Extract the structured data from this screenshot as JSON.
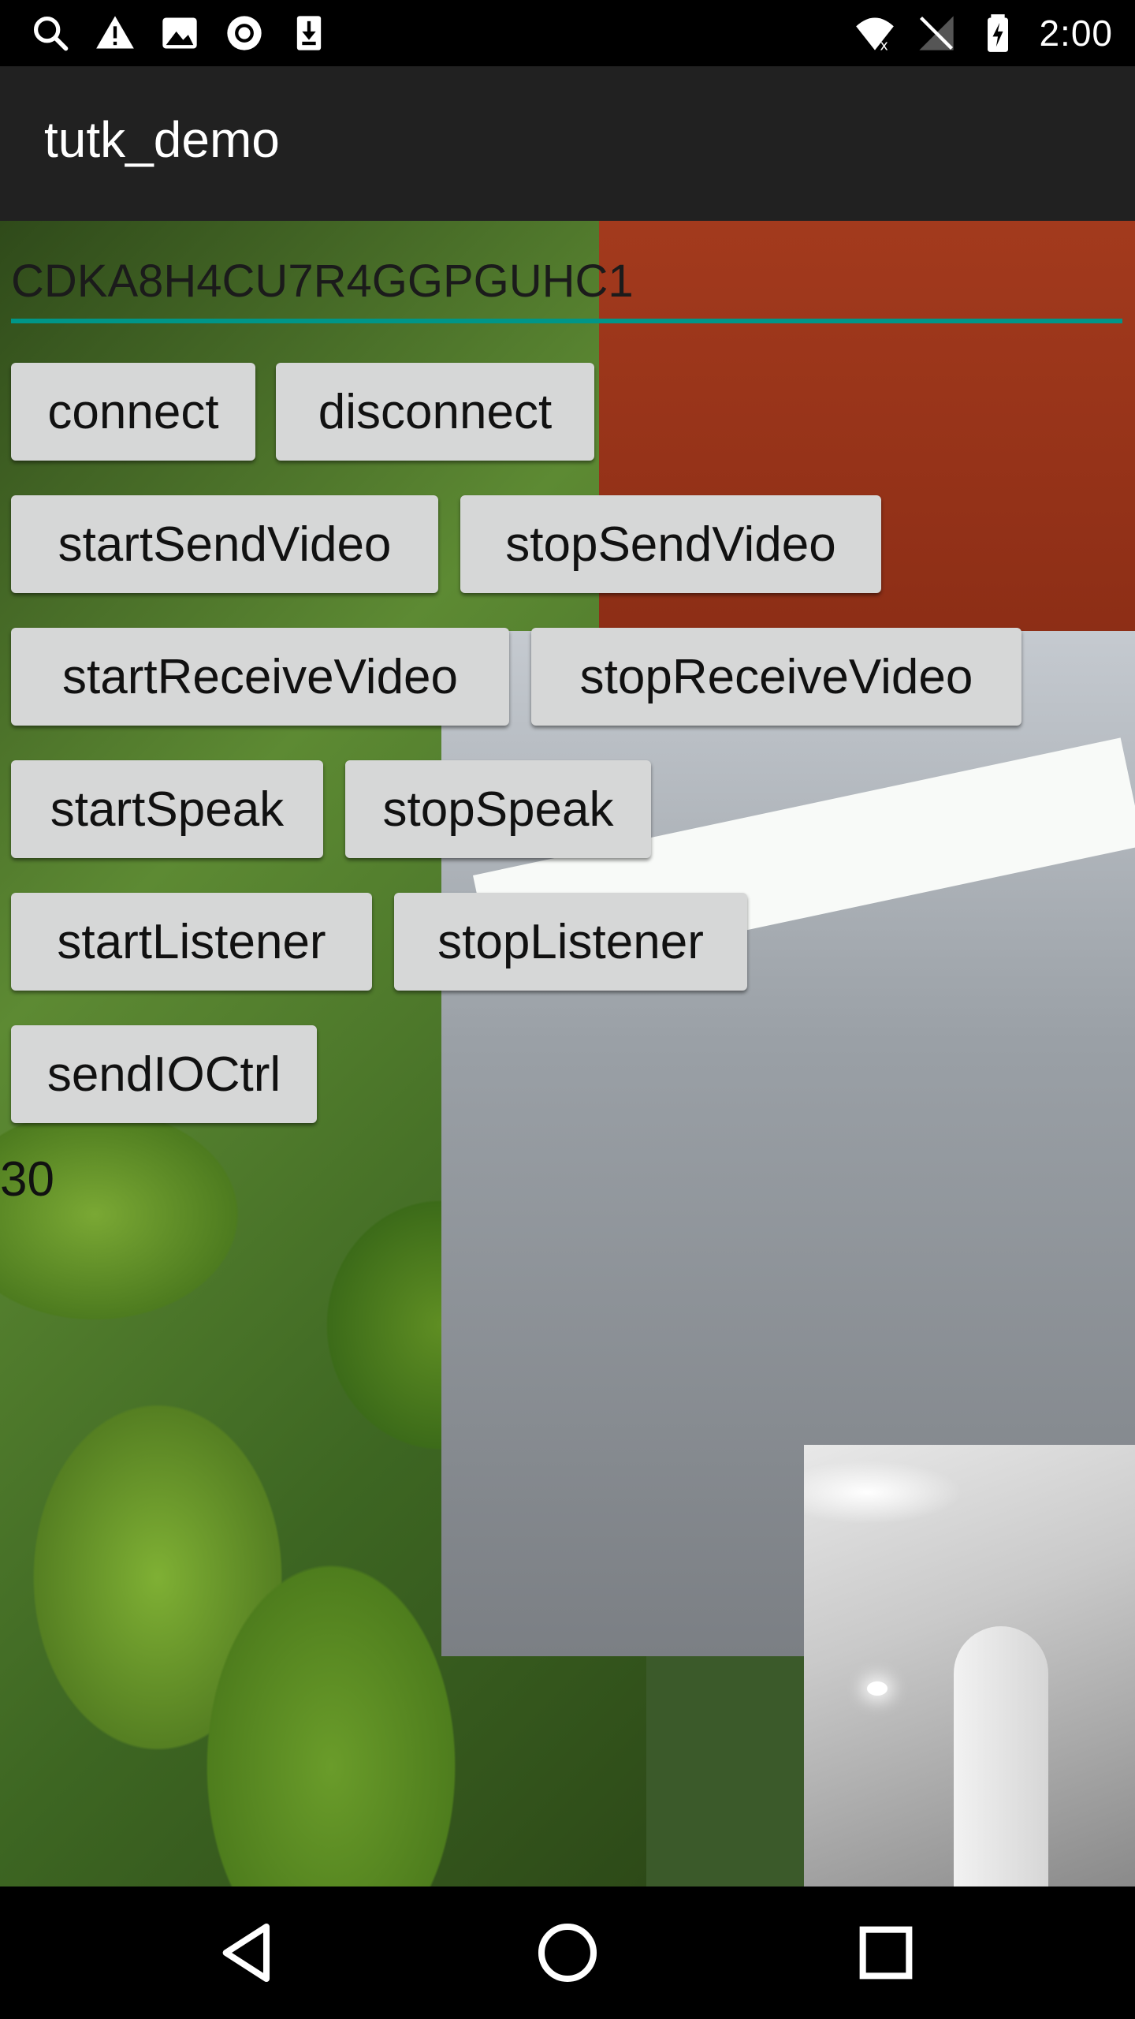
{
  "status_bar": {
    "time": "2:00",
    "left_icons": [
      "search-icon",
      "warning-icon",
      "image-icon",
      "record-icon",
      "download-icon"
    ],
    "right_icons": [
      "wifi-icon",
      "no-sim-icon",
      "battery-icon"
    ]
  },
  "app_bar": {
    "title": "tutk_demo"
  },
  "uid_field": {
    "value": "CDKA8H4CU7R4GGPGUHC1",
    "accent_color": "#009688"
  },
  "buttons": {
    "connect": "connect",
    "disconnect": "disconnect",
    "start_send_video": "startSendVideo",
    "stop_send_video": "stopSendVideo",
    "start_receive_video": "startReceiveVideo",
    "stop_receive_video": "stopReceiveVideo",
    "start_speak": "startSpeak",
    "stop_speak": "stopSpeak",
    "start_listener": "startListener",
    "stop_listener": "stopListener",
    "send_io_ctrl": "sendIOCtrl"
  },
  "counter": "30",
  "nav_bar": {
    "icons": [
      "back-icon",
      "home-icon",
      "recents-icon"
    ]
  }
}
